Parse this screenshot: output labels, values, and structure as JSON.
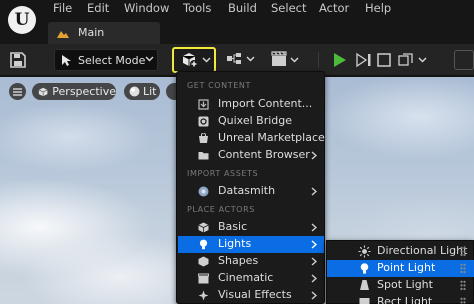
{
  "menubar": {
    "items": [
      "File",
      "Edit",
      "Window",
      "Tools",
      "Build",
      "Select",
      "Actor",
      "Help"
    ]
  },
  "tab": {
    "label": "Main",
    "icon": "level-icon"
  },
  "toolbar": {
    "select_mode_label": "Select Mode",
    "highlight_color": "#f0ea3c",
    "play_color": "#4dbb3a"
  },
  "viewport": {
    "perspective_label": "Perspective",
    "lit_label": "Lit"
  },
  "add_menu": {
    "sections": {
      "get_content": "GET CONTENT",
      "import_assets": "IMPORT ASSETS",
      "place_actors": "PLACE ACTORS"
    },
    "items": [
      {
        "label": "Import Content...",
        "icon": "import-icon",
        "submenu": false
      },
      {
        "label": "Quixel Bridge",
        "icon": "quixel-icon",
        "submenu": false
      },
      {
        "label": "Unreal Marketplace",
        "icon": "marketplace-icon",
        "submenu": false
      },
      {
        "label": "Content Browser",
        "icon": "folder-icon",
        "submenu": true
      },
      {
        "label": "Datasmith",
        "icon": "datasmith-icon",
        "submenu": true
      },
      {
        "label": "Basic",
        "icon": "cube-icon",
        "submenu": true
      },
      {
        "label": "Lights",
        "icon": "light-bulb-icon",
        "submenu": true,
        "active": true
      },
      {
        "label": "Shapes",
        "icon": "shapes-icon",
        "submenu": true
      },
      {
        "label": "Cinematic",
        "icon": "cinematic-icon",
        "submenu": true
      },
      {
        "label": "Visual Effects",
        "icon": "visual-effects-icon",
        "submenu": true
      }
    ],
    "accent_color": "#0a6de3"
  },
  "lights_menu": {
    "items": [
      {
        "label": "Directional Light",
        "icon": "directional-light-icon"
      },
      {
        "label": "Point Light",
        "icon": "point-light-icon",
        "active": true
      },
      {
        "label": "Spot Light",
        "icon": "spot-light-icon"
      },
      {
        "label": "Rect Light",
        "icon": "rect-light-icon"
      }
    ]
  }
}
